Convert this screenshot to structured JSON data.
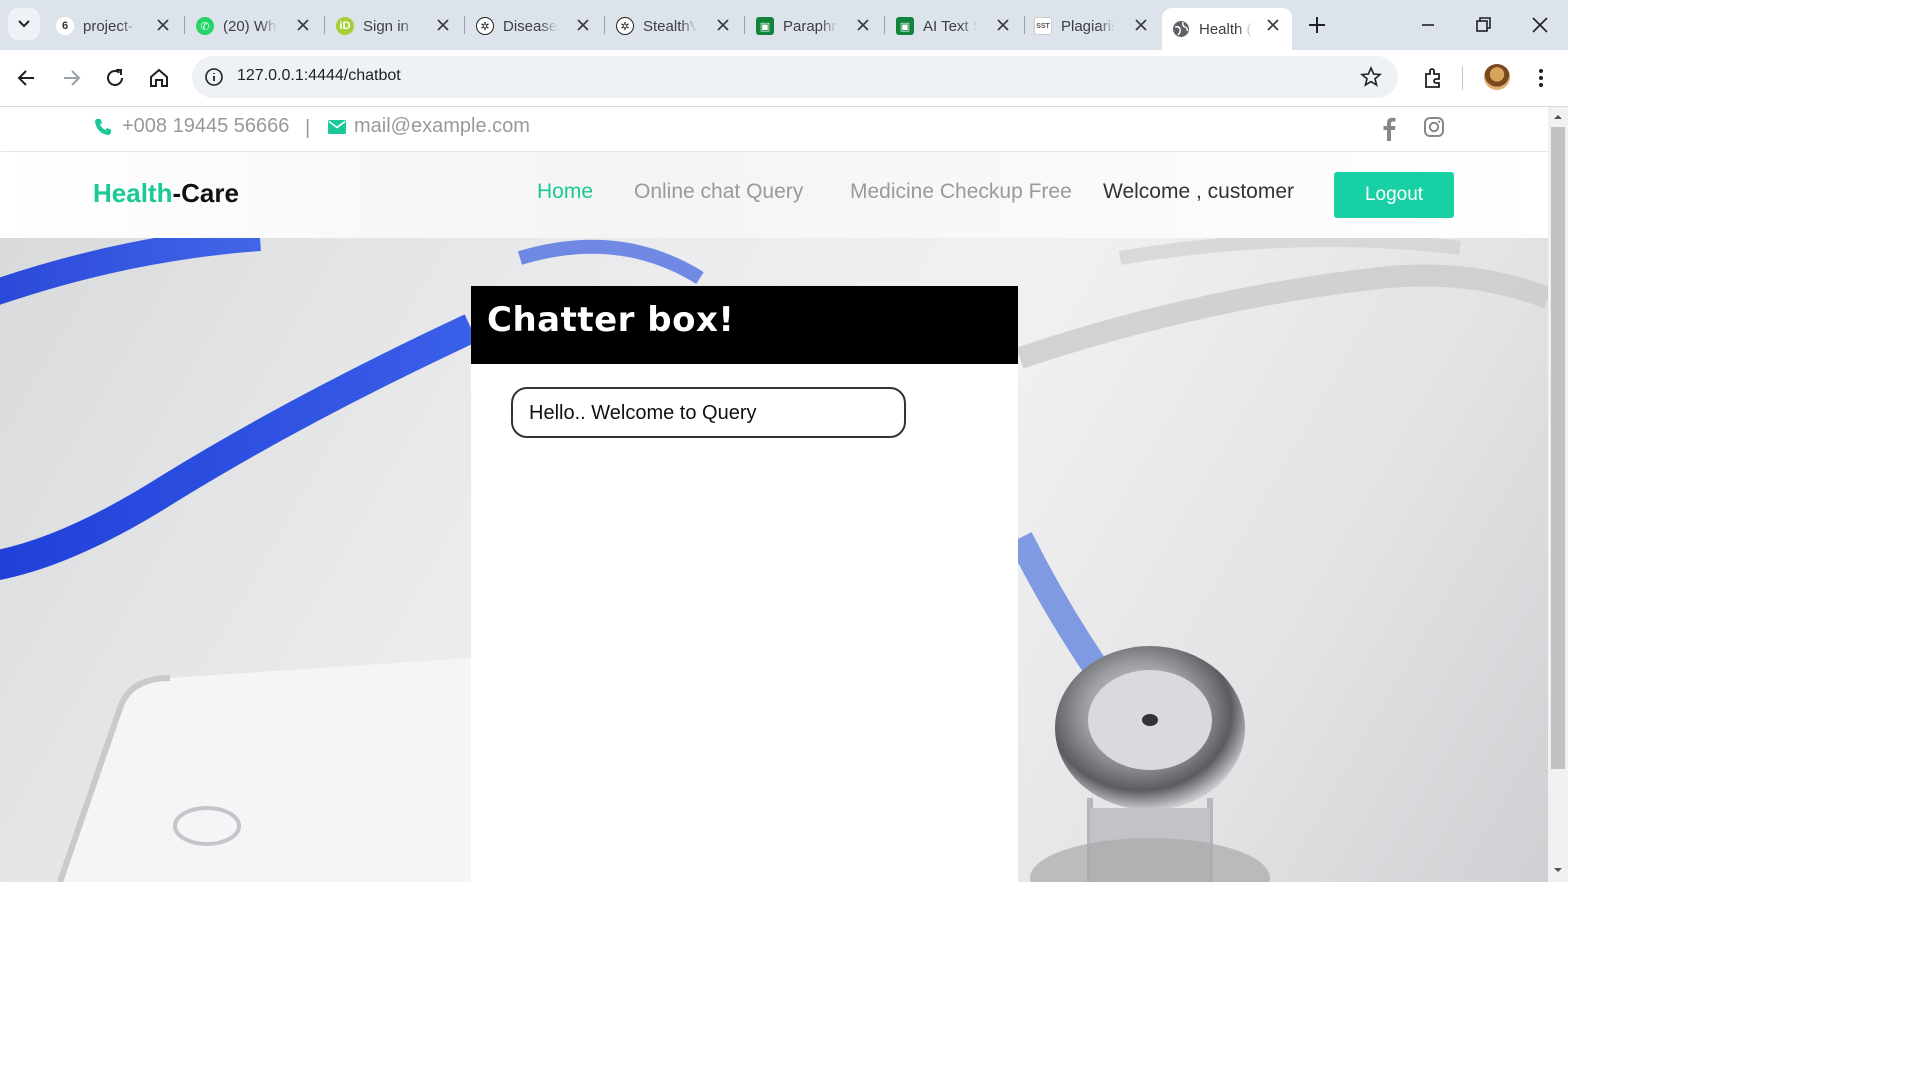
{
  "browser": {
    "tabs": [
      {
        "label": "project-",
        "icon": "project-favicon-icon"
      },
      {
        "label": "(20) Wh",
        "icon": "whatsapp-icon"
      },
      {
        "label": "Sign in",
        "icon": "orcid-icon"
      },
      {
        "label": "Disease",
        "icon": "openai-icon"
      },
      {
        "label": "StealthV",
        "icon": "stealth-icon"
      },
      {
        "label": "Paraphr",
        "icon": "paraphrase-icon"
      },
      {
        "label": "AI Text S",
        "icon": "ai-text-icon"
      },
      {
        "label": "Plagiaris",
        "icon": "plagiarism-icon",
        "badge": "SST"
      },
      {
        "label": "Health (",
        "icon": "globe-icon",
        "active": true
      }
    ],
    "url": "127.0.0.1:4444/chatbot"
  },
  "topbar": {
    "phone": "+008 19445 56666",
    "separator": "|",
    "email": "mail@example.com"
  },
  "header": {
    "brand_part1": "Health",
    "brand_part2": "-Care",
    "nav": [
      "Home",
      "Online chat Query",
      "Medicine Checkup Free"
    ],
    "welcome": "Welcome , customer",
    "logout_label": "Logout"
  },
  "chat": {
    "title": "Chatter box!",
    "messages": [
      "Hello.. Welcome to Query"
    ]
  },
  "colors": {
    "accent": "#1ac995",
    "button": "#17d1a4",
    "chat_header": "#000000"
  }
}
